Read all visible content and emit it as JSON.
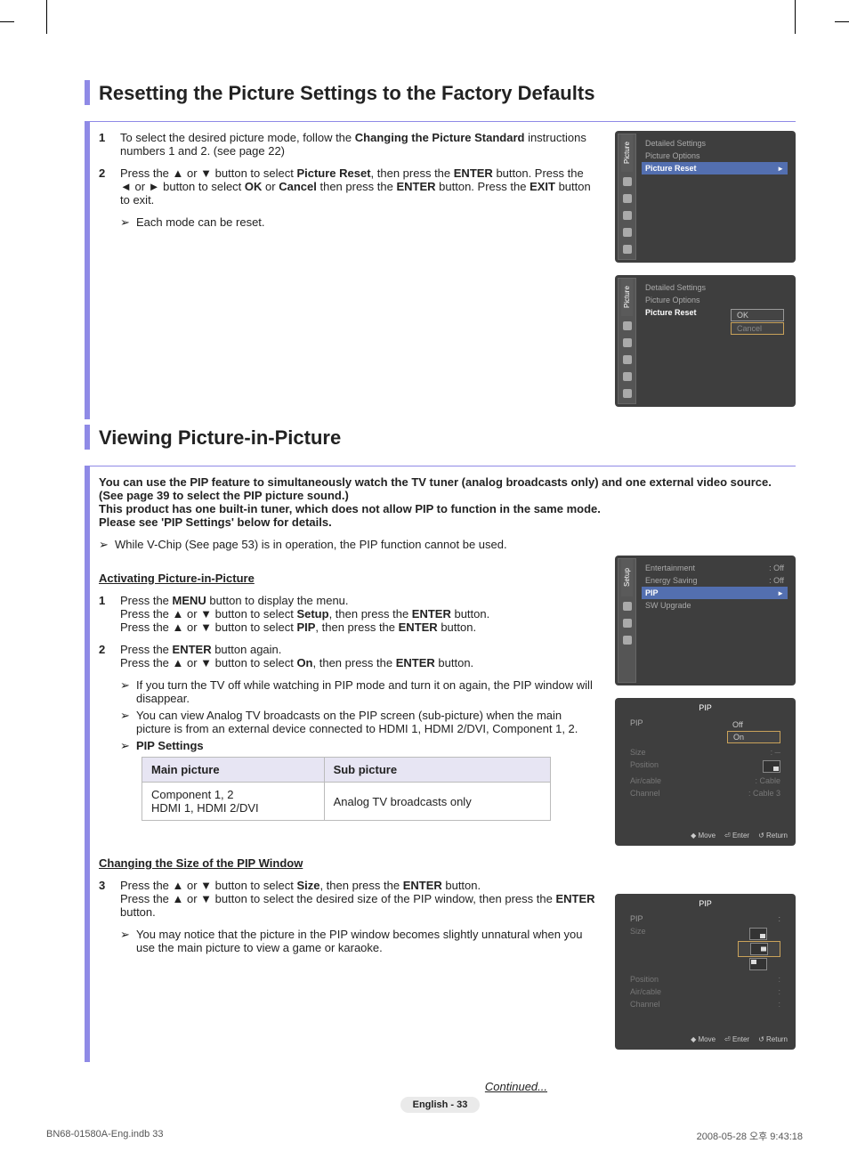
{
  "section1": {
    "title": "Resetting the Picture Settings to the Factory Defaults",
    "step1_html": "To select the desired picture mode, follow the <b>Changing the Picture Standard</b> instructions numbers 1 and 2. (see page 22)",
    "step2_html": "Press the ▲ or ▼ button to select <b>Picture Reset</b>, then press the <b>ENTER</b> button. Press the ◄ or ► button to select <b>OK</b> or <b>Cancel</b> then press the <b>ENTER</b> button. Press the <b>EXIT</b> button to exit.",
    "note1": "Each mode can be reset."
  },
  "osd1": {
    "tab": "Picture",
    "row1": "Detailed Settings",
    "row2": "Picture Options",
    "row3": "Picture Reset"
  },
  "osd2": {
    "tab": "Picture",
    "row1": "Detailed Settings",
    "row2": "Picture Options",
    "row3": "Picture Reset",
    "opt_ok": "OK",
    "opt_cancel": "Cancel"
  },
  "section2": {
    "title": "Viewing Picture-in-Picture",
    "intro_html": "You can use the PIP feature to simultaneously watch the TV tuner (analog broadcasts only) and one external video source. (See page 39 to select the PIP picture sound.)<br>This product has one built-in tuner, which does not allow PIP to function in the same mode.<br>Please see 'PIP Settings' below for details.",
    "note_top": "While V-Chip (See page 53) is in operation, the PIP function cannot be used.",
    "h_activate": "Activating Picture-in-Picture",
    "step1_html": "Press the <b>MENU</b> button to display the menu.<br>Press the ▲ or ▼ button to select <b>Setup</b>, then press the <b>ENTER</b> button.<br>Press the ▲ or ▼ button to select <b>PIP</b>, then press the <b>ENTER</b> button.",
    "step2_html": "Press the <b>ENTER</b> button again.<br>Press the ▲ or ▼ button to select <b>On</b>, then press the <b>ENTER</b> button.",
    "note2a": "If you turn the TV off while watching in PIP mode and turn it on again, the PIP window will disappear.",
    "note2b": "You can view Analog TV broadcasts on the PIP screen (sub-picture) when the main picture is from an external device connected to HDMI 1, HDMI 2/DVI, Component 1, 2.",
    "note2c": "PIP Settings",
    "table": {
      "h1": "Main picture",
      "h2": "Sub picture",
      "c1": "Component 1, 2\nHDMI 1, HDMI 2/DVI",
      "c2": "Analog TV broadcasts only"
    },
    "h_size": "Changing the Size of the PIP Window",
    "step3_html": "Press the ▲ or ▼ button to select <b>Size</b>, then press the <b>ENTER</b> button.<br>Press the ▲ or ▼ button to select the desired size of the PIP window, then press the <b>ENTER</b> button.",
    "note3": "You may notice that the picture in the PIP window becomes slightly unnatural when you use the main picture to view a game or karaoke."
  },
  "osd3": {
    "tab": "Setup",
    "rows": [
      {
        "k": "Entertainment",
        "v": ": Off"
      },
      {
        "k": "Energy Saving",
        "v": ": Off"
      }
    ],
    "hi": "PIP",
    "last": "SW Upgrade"
  },
  "osd4": {
    "title": "PIP",
    "rows": [
      "PIP",
      "Size",
      "Position",
      "Air/cable",
      "Channel"
    ],
    "vals": [
      "Off",
      "On",
      ": ─",
      ": Cable",
      ": Cable 3"
    ],
    "foot": {
      "move": "◆ Move",
      "enter": "⏎ Enter",
      "ret": "↺ Return"
    }
  },
  "osd5": {
    "title": "PIP",
    "rows": [
      "PIP",
      "Size",
      "Position",
      "Air/cable",
      "Channel"
    ],
    "foot": {
      "move": "◆ Move",
      "enter": "⏎ Enter",
      "ret": "↺ Return"
    }
  },
  "continued": "Continued...",
  "lang": "English - 33",
  "footer": {
    "left": "BN68-01580A-Eng.indb   33",
    "right": "2008-05-28   오후 9:43:18"
  },
  "num": {
    "1": "1",
    "2": "2",
    "3": "3"
  }
}
